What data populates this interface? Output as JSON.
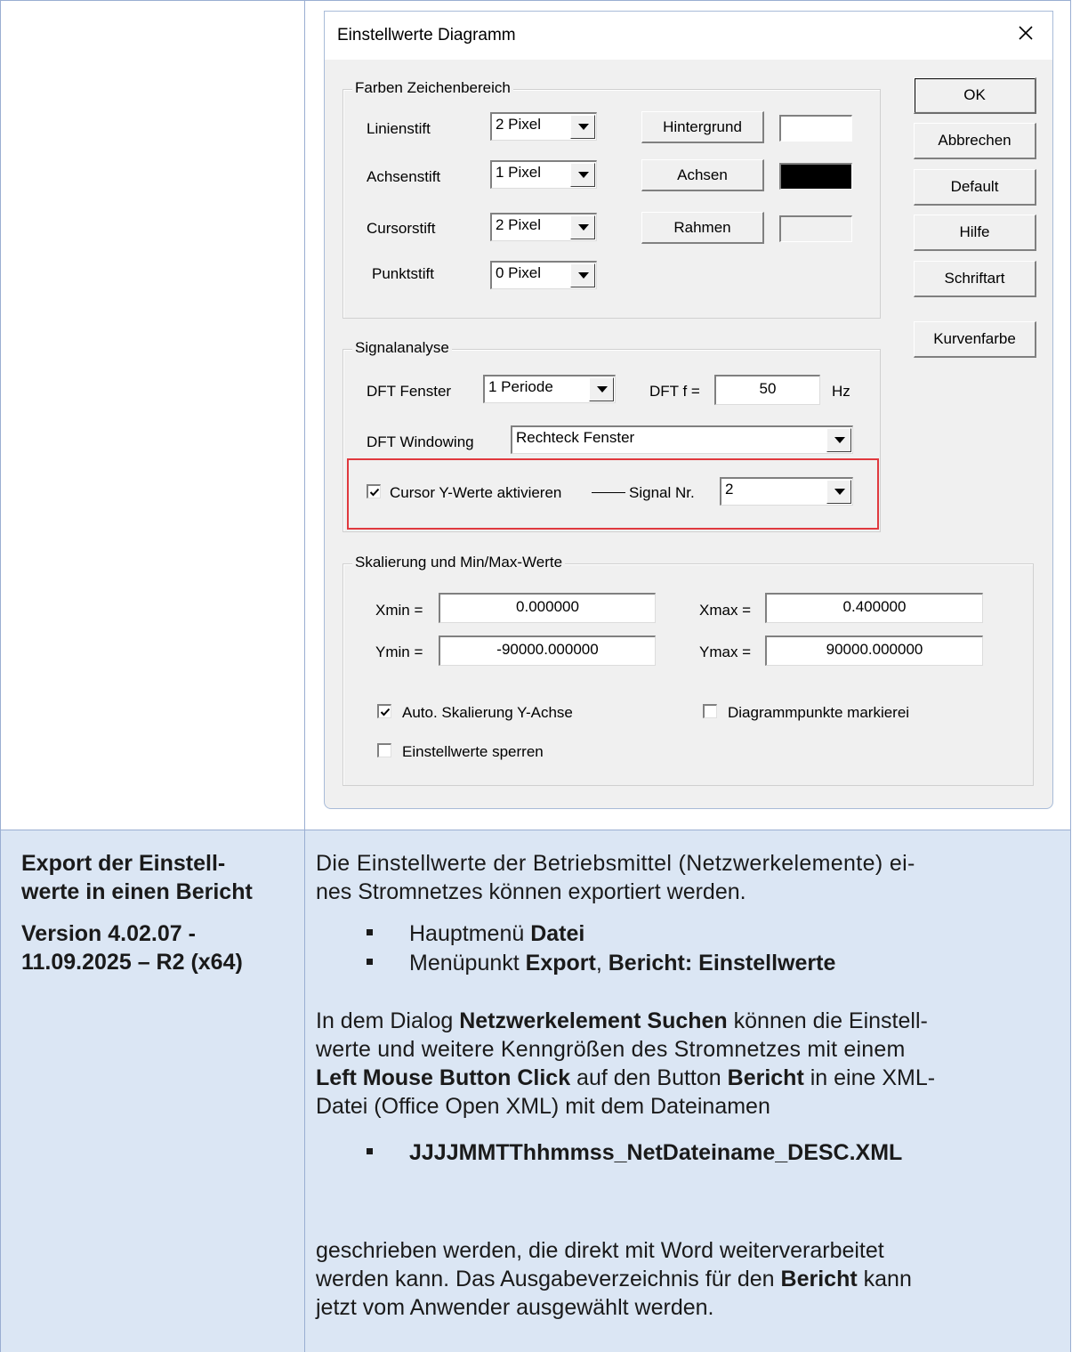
{
  "dialog": {
    "title": "Einstellwerte Diagramm",
    "close_glyph": "✕",
    "farben": {
      "legend": "Farben Zeichenbereich",
      "rows": [
        {
          "label": "Linienstift",
          "value": "2 Pixel",
          "button": "Hintergrund",
          "swatch_color": "#ffffff"
        },
        {
          "label": "Achsenstift",
          "value": "1 Pixel",
          "button": "Achsen",
          "swatch_color": "#000000"
        },
        {
          "label": "Cursorstift",
          "value": "2 Pixel",
          "button": "Rahmen",
          "swatch_color": "#f0f0f0"
        },
        {
          "label": "Punktstift",
          "value": "0 Pixel"
        }
      ]
    },
    "side_buttons": [
      "OK",
      "Abbrechen",
      "Default",
      "Hilfe",
      "Schriftart",
      "Kurvenfarbe"
    ],
    "signal": {
      "legend": "Signalanalyse",
      "dft_fenster_label": "DFT Fenster",
      "dft_fenster_value": "1 Periode",
      "dft_f_label": "DFT f =",
      "dft_f_value": "50",
      "hz": "Hz",
      "windowing_label": "DFT Windowing",
      "windowing_value": "Rechteck Fenster",
      "cursor_label": "Cursor Y-Werte aktivieren",
      "cursor_checked": true,
      "signal_nr_label": "Signal Nr.",
      "signal_nr_value": "2"
    },
    "skal": {
      "legend": "Skalierung und Min/Max-Werte",
      "xmin_label": "Xmin =",
      "xmin": "0.000000",
      "xmax_label": "Xmax =",
      "xmax": "0.400000",
      "ymin_label": "Ymin =",
      "ymin": "-90000.000000",
      "ymax_label": "Ymax =",
      "ymax": "90000.000000",
      "auto_label": "Auto. Skalierung Y-Achse",
      "auto_checked": true,
      "punkte_label": "Diagrammpunkte markierei",
      "punkte_checked": false,
      "sperren_label": "Einstellwerte sperren",
      "sperren_checked": false
    }
  },
  "doc": {
    "left_title_1": "Export der Einstell-",
    "left_title_2": "werte in einen Bericht",
    "version_1": "Version 4.02.07 -",
    "version_2": "11.09.2025 – R2 (x64)",
    "p1_line1": "Die Einstellwerte der Betriebsmittel (Netzwerkelemente) ei-",
    "p1_line2": "nes Stromnetzes können exportiert werden.",
    "bullet1_pre": "Hauptmenü ",
    "bullet1_bold": "Datei",
    "bullet2_pre": "Menüpunkt ",
    "bullet2_bold1": "Export",
    "bullet2_sep": ", ",
    "bullet2_bold2": "Bericht: Einstellwerte",
    "p2_l1_pre": "In dem Dialog ",
    "p2_l1_bold": "Netzwerkelement Suchen",
    "p2_l1_post": " können die Einstell-",
    "p2_l2": "werte und weitere Kenngrößen des Stromnetzes mit einem",
    "p2_l3_bold1": "Left Mouse Button Click",
    "p2_l3_mid": " auf den Button ",
    "p2_l3_bold2": "Bericht",
    "p2_l3_post": " in eine XML-",
    "p2_l4": "Datei (Office Open XML) mit dem Dateinamen",
    "bullet3": "JJJJMMTThhmmss_NetDateiname_DESC.XML",
    "p3_l1": "geschrieben werden, die direkt mit Word weiterverarbeitet",
    "p3_l2_pre": "werden kann. Das Ausgabeverzeichnis für den ",
    "p3_l2_bold": "Bericht",
    "p3_l2_post": " kann",
    "p3_l3": "jetzt vom Anwender ausgewählt werden."
  }
}
